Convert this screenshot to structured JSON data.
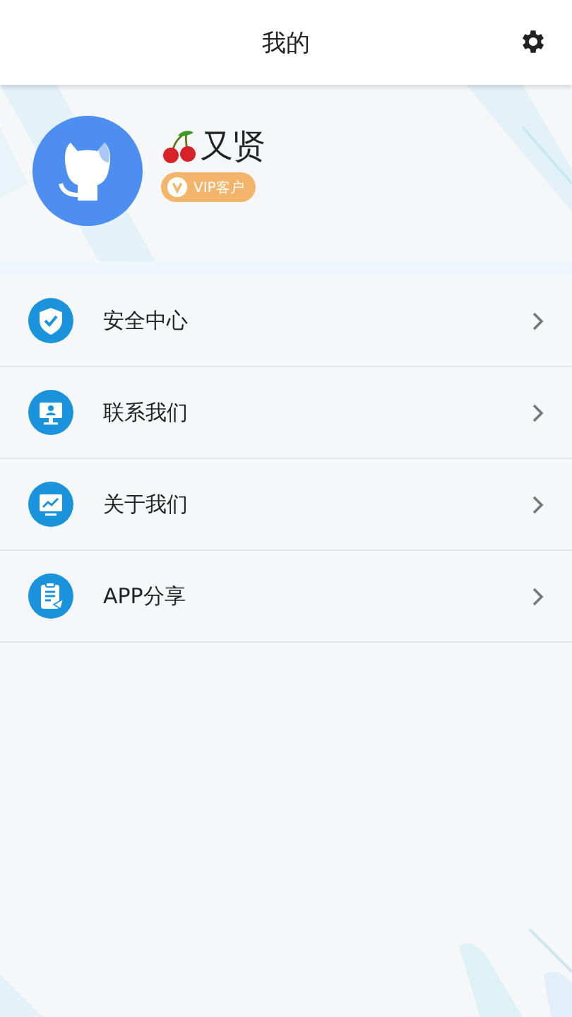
{
  "header": {
    "title": "我的"
  },
  "profile": {
    "name": "又贤",
    "badge": "VIP客户"
  },
  "menu": [
    {
      "kind": "shield",
      "label": "安全中心"
    },
    {
      "kind": "contact",
      "label": "联系我们"
    },
    {
      "kind": "chart",
      "label": "关于我们"
    },
    {
      "kind": "share",
      "label": "APP分享"
    }
  ]
}
